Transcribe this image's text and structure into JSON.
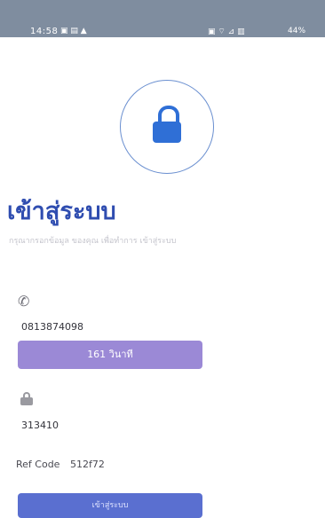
{
  "status_bar": {
    "time": "14:58",
    "left_icons": "▣ ▤ ▲",
    "right_icons": "▣ ⌔ ⊿ ▥",
    "battery": "44%"
  },
  "login": {
    "title": "เข้าสู่ระบบ",
    "subtitle": "กรุณากรอกข้อมูล ของคุณ เพื่อทำการ เข้าสู่ระบบ",
    "phone_icon": "phone-icon",
    "phone_value": "0813874098",
    "countdown_label": "161 วินาที",
    "otp_value": "313410",
    "ref_code_label": "Ref Code",
    "ref_code_value": "512f72",
    "login_button_label": "เข้าสู่ระบบ"
  },
  "colors": {
    "accent_blue": "#2f6fd6",
    "countdown_purple": "#9b89d6",
    "button_blue": "#5a6fd0"
  }
}
